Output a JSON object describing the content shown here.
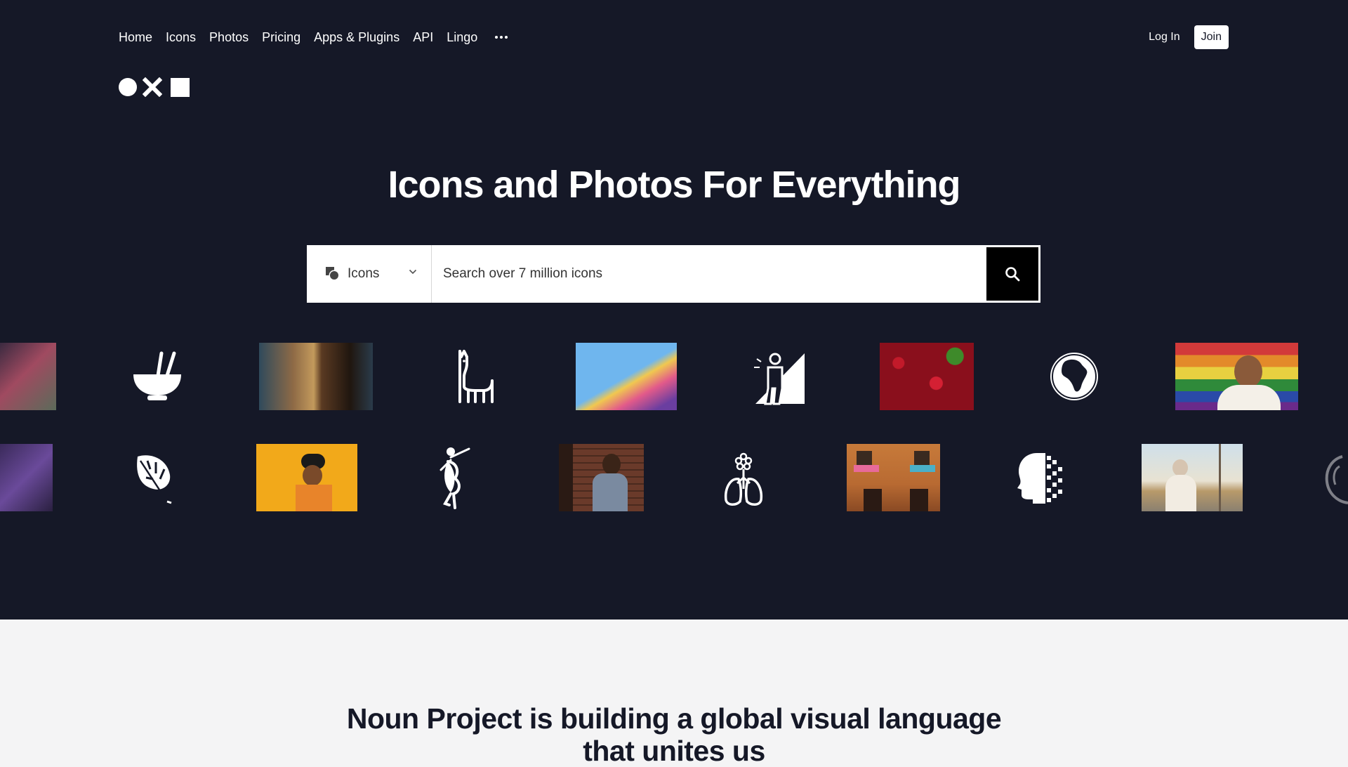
{
  "nav": {
    "items": [
      {
        "label": "Home"
      },
      {
        "label": "Icons"
      },
      {
        "label": "Photos"
      },
      {
        "label": "Pricing"
      },
      {
        "label": "Apps & Plugins"
      },
      {
        "label": "API"
      },
      {
        "label": "Lingo"
      }
    ],
    "more_icon": "more-dots-icon"
  },
  "auth": {
    "login_label": "Log In",
    "join_label": "Join"
  },
  "logo": {
    "icons": [
      "circle-icon",
      "x-icon",
      "square-icon"
    ]
  },
  "hero": {
    "headline": "Icons and Photos For Everything"
  },
  "search": {
    "type_selected": "Icons",
    "type_icon": "icons-type-icon",
    "placeholder": "Search over 7 million icons",
    "button_icon": "search-icon"
  },
  "gallery": {
    "row1": [
      "photo-cropped-left",
      "bowl-chopsticks-icon",
      "photo-two-women",
      "llama-icon",
      "photo-colorful-paper",
      "person-ramp-icon",
      "photo-cherries",
      "globe-africa-icon",
      "photo-rainbow-flag-man"
    ],
    "row2": [
      "photo-purple-flowers",
      "monstera-leaf-icon",
      "photo-woman-yellow",
      "dancer-icon",
      "photo-man-brick-wall",
      "flower-lungs-icon",
      "photo-building-balconies",
      "pixel-head-icon",
      "photo-woman-boat",
      "partial-icon-right"
    ]
  },
  "mission": {
    "line1": "Noun Project is building a global visual language",
    "line2": "that unites us"
  },
  "colors": {
    "hero_bg": "#151827",
    "page_bg": "#f4f4f5",
    "search_button": "#000000"
  }
}
